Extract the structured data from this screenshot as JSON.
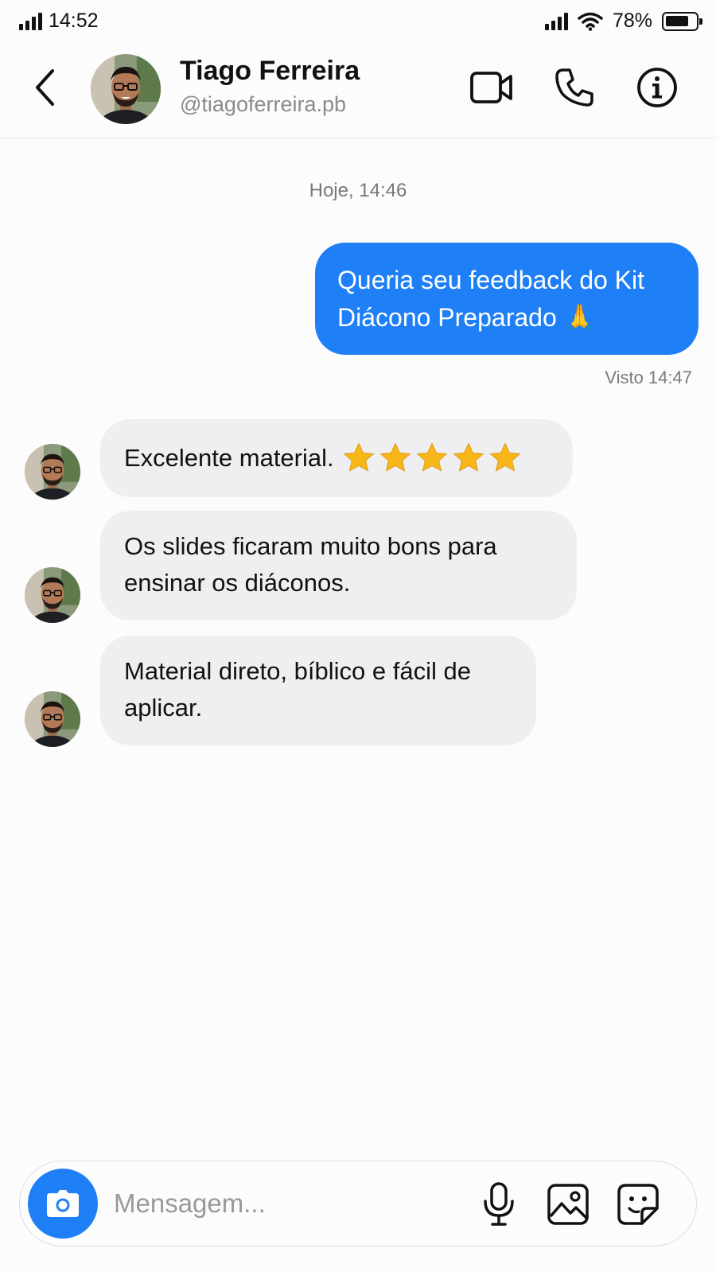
{
  "status_bar": {
    "time": "14:52",
    "battery_text": "78%",
    "battery_level": 0.78,
    "icons": [
      "signal-icon",
      "wifi-icon",
      "battery-icon"
    ]
  },
  "header": {
    "contact_name": "Tiago Ferreira",
    "contact_handle": "@tiagoferreira.pb",
    "icons": [
      "back-arrow-icon",
      "video-call-icon",
      "phone-icon",
      "info-icon"
    ]
  },
  "chat": {
    "date_label": "Hoje, 14:46",
    "outgoing": {
      "text": "Queria seu feedback do Kit Diácono Preparado 🙏",
      "seen_label": "Visto 14:47"
    },
    "incoming": [
      {
        "text": "Excelente material.",
        "stars": 5
      },
      {
        "text": "Os slides ficaram muito bons para ensinar os diáconos."
      },
      {
        "text": "Material direto, bíblico e fácil de aplicar."
      }
    ]
  },
  "composer": {
    "placeholder": "Mensagem...",
    "value": "",
    "icons": [
      "camera-icon",
      "microphone-icon",
      "image-icon",
      "sticker-icon"
    ]
  },
  "colors": {
    "accent": "#1e7ff6",
    "incoming_bubble": "#efeef1",
    "background": "#fdfcfd",
    "star": "#f7b719"
  }
}
